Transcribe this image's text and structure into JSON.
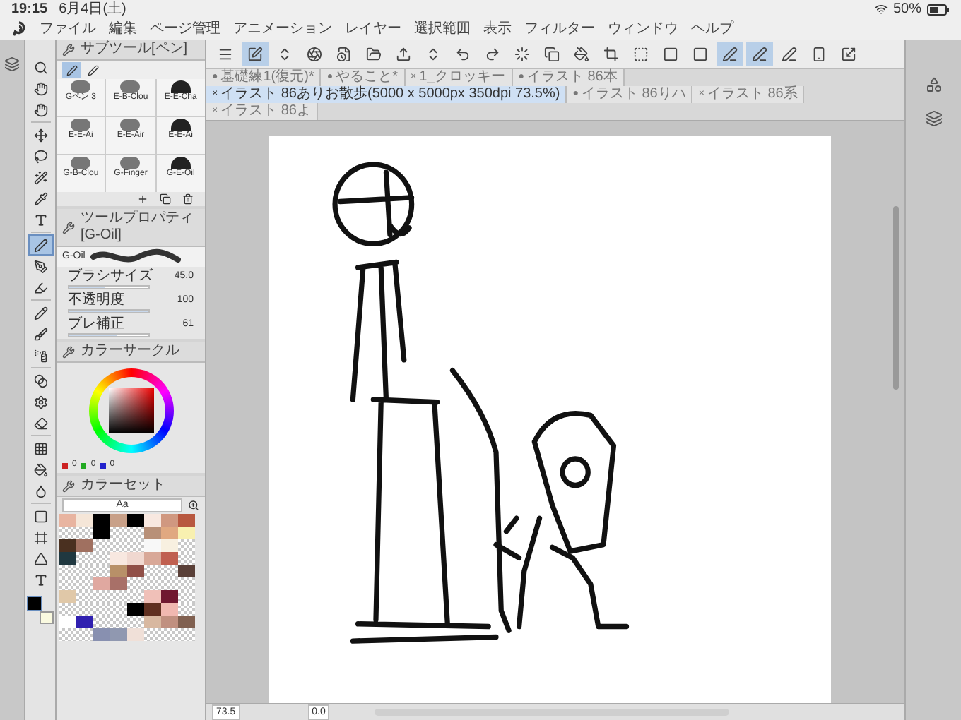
{
  "status_bar": {
    "time": "19:15",
    "date": "6月4日(土)",
    "battery": "50%"
  },
  "menu": [
    "ファイル",
    "編集",
    "ページ管理",
    "アニメーション",
    "レイヤー",
    "選択範囲",
    "表示",
    "フィルター",
    "ウィンドウ",
    "ヘルプ"
  ],
  "toolbar": [
    {
      "selected": false
    },
    {
      "selected": true
    },
    {
      "selected": false
    },
    {
      "selected": false
    },
    {
      "selected": false
    },
    {
      "selected": false
    },
    {
      "selected": false
    },
    {
      "selected": false
    },
    {
      "selected": false
    },
    {
      "selected": false
    },
    {
      "selected": false
    },
    {
      "selected": false
    },
    {
      "selected": false
    },
    {
      "selected": false
    },
    {
      "selected": false
    },
    {
      "selected": false
    },
    {
      "selected": false
    },
    {
      "selected": true
    },
    {
      "selected": true
    },
    {
      "selected": false
    },
    {
      "selected": false
    },
    {
      "selected": false
    }
  ],
  "tabs": [
    {
      "marker": "●",
      "label": "基礎練1(復元)*",
      "selected": false
    },
    {
      "marker": "●",
      "label": "やること*",
      "selected": false
    },
    {
      "marker": "×",
      "label": "1_クロッキー",
      "selected": false
    },
    {
      "marker": "●",
      "label": "イラスト 86本",
      "selected": false
    },
    {
      "marker": "×",
      "label": "イラスト 86ありお散歩(5000 x 5000px 350dpi 73.5%)",
      "selected": true
    },
    {
      "marker": "●",
      "label": "イラスト 86りハ",
      "selected": false
    },
    {
      "marker": "×",
      "label": "イラスト 86系",
      "selected": false
    },
    {
      "marker": "×",
      "label": "イラスト 86よ",
      "selected": false
    }
  ],
  "subtool_panel": {
    "title": "サブツール[ペン]",
    "subtool_tabs": [
      {
        "selected": true
      },
      {
        "selected": false
      }
    ],
    "brushes": [
      {
        "label": "Gペン 3"
      },
      {
        "label": "E-B-Clou"
      },
      {
        "label": "E-E-Cha"
      },
      {
        "label": "E-E-Ai"
      },
      {
        "label": "E-E-Air"
      },
      {
        "label": "E-E-Ai"
      },
      {
        "label": "G-B-Clou"
      },
      {
        "label": "G-Finger"
      },
      {
        "label": "G-E-Oil"
      }
    ]
  },
  "tool_property": {
    "title": "ツールプロパティ[G-Oil]",
    "brush_name": "G-Oil",
    "properties": [
      {
        "label": "ブラシサイズ",
        "value": "45.0",
        "level": 0.45
      },
      {
        "label": "不透明度",
        "value": "100",
        "level": 1
      },
      {
        "label": "ブレ補正",
        "value": "61",
        "level": 0.61
      }
    ]
  },
  "color_circle": {
    "title": "カラーサークル",
    "readouts": [
      "0",
      "0",
      "0"
    ]
  },
  "color_set": {
    "title": "カラーセット",
    "set_name": "Aa",
    "swatch_rows": [
      [
        {
          "kind": "color",
          "color": "#e8b4a0"
        },
        {
          "kind": "color",
          "color": "#f5e6d8"
        },
        {
          "kind": "color",
          "color": "#000000"
        },
        {
          "kind": "color",
          "color": "#c8a088"
        },
        {
          "kind": "color",
          "color": "#000000"
        },
        {
          "kind": "color",
          "color": "#f8e8e0"
        },
        {
          "kind": "color",
          "color": "#d09880"
        },
        {
          "kind": "color",
          "color": "#b85840"
        }
      ],
      [
        {
          "kind": "empty"
        },
        {
          "kind": "empty"
        },
        {
          "kind": "color",
          "color": "#000000"
        },
        {
          "kind": "empty"
        },
        {
          "kind": "empty"
        },
        {
          "kind": "color",
          "color": "#b89078"
        },
        {
          "kind": "color",
          "color": "#e0a880"
        },
        {
          "kind": "color",
          "color": "#f8f0b0"
        }
      ],
      [
        {
          "kind": "color",
          "color": "#4a3020"
        },
        {
          "kind": "color",
          "color": "#a07060"
        },
        {
          "kind": "empty"
        },
        {
          "kind": "empty"
        },
        {
          "kind": "empty"
        },
        {
          "kind": "color",
          "color": "#f8f8f8"
        },
        {
          "kind": "color",
          "color": "#f8f0e0"
        },
        {
          "kind": "empty"
        }
      ],
      [
        {
          "kind": "color",
          "color": "#203840"
        },
        {
          "kind": "empty"
        },
        {
          "kind": "empty"
        },
        {
          "kind": "color",
          "color": "#f8e8e0"
        },
        {
          "kind": "color",
          "color": "#f0d8d0"
        },
        {
          "kind": "color",
          "color": "#d8a898"
        },
        {
          "kind": "color",
          "color": "#c06050"
        },
        {
          "kind": "empty"
        }
      ],
      [
        {
          "kind": "empty"
        },
        {
          "kind": "empty"
        },
        {
          "kind": "empty"
        },
        {
          "kind": "color",
          "color": "#b89068"
        },
        {
          "kind": "color",
          "color": "#905048"
        },
        {
          "kind": "empty"
        },
        {
          "kind": "empty"
        },
        {
          "kind": "color",
          "color": "#5a4038"
        }
      ],
      [
        {
          "kind": "empty"
        },
        {
          "kind": "empty"
        },
        {
          "kind": "color",
          "color": "#e0a8a0"
        },
        {
          "kind": "color",
          "color": "#a87068"
        },
        {
          "kind": "empty"
        },
        {
          "kind": "empty"
        },
        {
          "kind": "empty"
        },
        {
          "kind": "empty"
        }
      ],
      [
        {
          "kind": "color",
          "color": "#e0c8a8"
        },
        {
          "kind": "empty"
        },
        {
          "kind": "empty"
        },
        {
          "kind": "empty"
        },
        {
          "kind": "empty"
        },
        {
          "kind": "color",
          "color": "#f0c0b8"
        },
        {
          "kind": "color",
          "color": "#701830"
        },
        {
          "kind": "empty"
        }
      ],
      [
        {
          "kind": "empty"
        },
        {
          "kind": "empty"
        },
        {
          "kind": "empty"
        },
        {
          "kind": "empty"
        },
        {
          "kind": "color",
          "color": "#000000"
        },
        {
          "kind": "color",
          "color": "#603020"
        },
        {
          "kind": "color",
          "color": "#f0b8b0"
        },
        {
          "kind": "empty"
        }
      ],
      [
        {
          "kind": "color",
          "color": "#ffffff"
        },
        {
          "kind": "color",
          "color": "#3020b0"
        },
        {
          "kind": "empty"
        },
        {
          "kind": "empty"
        },
        {
          "kind": "empty"
        },
        {
          "kind": "color",
          "color": "#d8b8a0"
        },
        {
          "kind": "color",
          "color": "#c09080"
        },
        {
          "kind": "color",
          "color": "#806050"
        }
      ],
      [
        {
          "kind": "empty"
        },
        {
          "kind": "empty"
        },
        {
          "kind": "color",
          "color": "#8890b0"
        },
        {
          "kind": "color",
          "color": "#9098b0"
        },
        {
          "kind": "color",
          "color": "#f0e0d8"
        },
        {
          "kind": "empty"
        },
        {
          "kind": "empty"
        },
        {
          "kind": "empty"
        }
      ]
    ]
  },
  "tools": [
    {
      "selected": false
    },
    {
      "selected": false
    },
    {
      "selected": false
    },
    {
      "selected": false
    },
    {
      "selected": false
    },
    {
      "selected": false
    },
    {
      "selected": false
    },
    {
      "selected": false
    },
    {
      "selected": true
    },
    {
      "selected": false
    },
    {
      "selected": false
    },
    {
      "selected": false
    },
    {
      "selected": false
    },
    {
      "selected": false
    },
    {
      "selected": false
    },
    {
      "selected": false
    },
    {
      "selected": false
    },
    {
      "selected": false
    },
    {
      "selected": false
    },
    {
      "selected": false
    },
    {
      "selected": false
    },
    {
      "selected": false
    },
    {
      "selected": false
    },
    {
      "selected": false
    }
  ],
  "current_colors": [
    {
      "color": "#000000"
    },
    {
      "color": "#fafae0"
    }
  ],
  "bottom_bar": {
    "zoom": "73.5",
    "angle": "0.0"
  }
}
